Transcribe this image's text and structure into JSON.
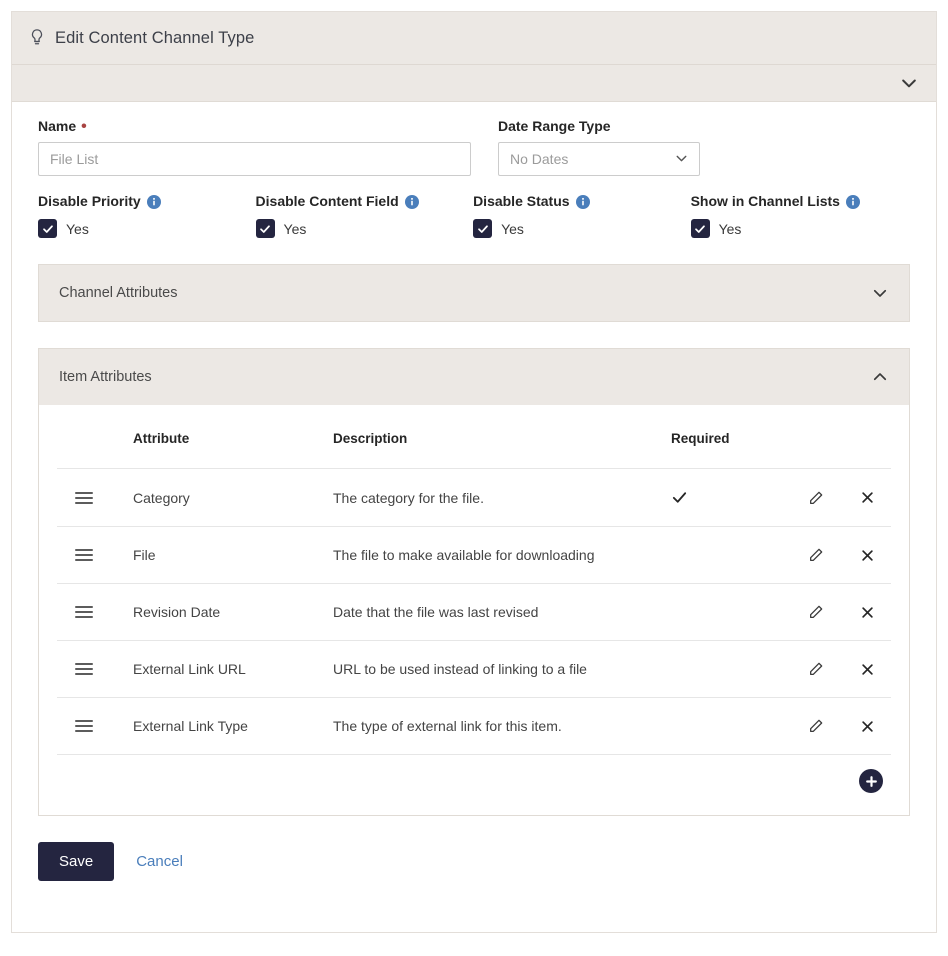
{
  "panel": {
    "title": "Edit Content Channel Type",
    "title_icon": "lightbulb-icon",
    "collapse_icon": "chevron-down-icon"
  },
  "form": {
    "name": {
      "label": "Name",
      "required_marker": "•",
      "value": "",
      "placeholder": "File List"
    },
    "date_range_type": {
      "label": "Date Range Type",
      "selected": "No Dates",
      "chevron_icon": "chevron-down-icon"
    },
    "checkboxes": [
      {
        "label": "Disable Priority",
        "info_icon": "info-icon",
        "state_label": "Yes",
        "checked": true
      },
      {
        "label": "Disable Content Field",
        "info_icon": "info-icon",
        "state_label": "Yes",
        "checked": true
      },
      {
        "label": "Disable Status",
        "info_icon": "info-icon",
        "state_label": "Yes",
        "checked": true
      },
      {
        "label": "Show in Channel Lists",
        "info_icon": "info-icon",
        "state_label": "Yes",
        "checked": true
      }
    ]
  },
  "channel_attributes": {
    "title": "Channel Attributes",
    "expanded": false,
    "chevron_icon": "chevron-down-icon"
  },
  "item_attributes": {
    "title": "Item Attributes",
    "expanded": true,
    "chevron_icon": "chevron-up-icon",
    "columns": {
      "handle": "",
      "attribute": "Attribute",
      "description": "Description",
      "required": "Required"
    },
    "rows": [
      {
        "handle_icon": "drag-handle-icon",
        "attribute": "Category",
        "description": "The category for the file.",
        "required": true,
        "edit_icon": "pencil-icon",
        "delete_icon": "close-icon"
      },
      {
        "handle_icon": "drag-handle-icon",
        "attribute": "File",
        "description": "The file to make available for downloading",
        "required": false,
        "edit_icon": "pencil-icon",
        "delete_icon": "close-icon"
      },
      {
        "handle_icon": "drag-handle-icon",
        "attribute": "Revision Date",
        "description": "Date that the file was last revised",
        "required": false,
        "edit_icon": "pencil-icon",
        "delete_icon": "close-icon"
      },
      {
        "handle_icon": "drag-handle-icon",
        "attribute": "External Link URL",
        "description": "URL to be used instead of linking to a file",
        "required": false,
        "edit_icon": "pencil-icon",
        "delete_icon": "close-icon"
      },
      {
        "handle_icon": "drag-handle-icon",
        "attribute": "External Link Type",
        "description": "The type of external link for this item.",
        "required": false,
        "edit_icon": "pencil-icon",
        "delete_icon": "close-icon"
      }
    ],
    "add_button_icon": "plus-circle-icon"
  },
  "footer": {
    "save_label": "Save",
    "cancel_label": "Cancel"
  },
  "colors": {
    "accent_dark": "#242540",
    "link": "#4a7ebb",
    "info_blue": "#4a7ebb",
    "required_red": "#a94442",
    "panel_header_bg": "#ece8e4"
  }
}
